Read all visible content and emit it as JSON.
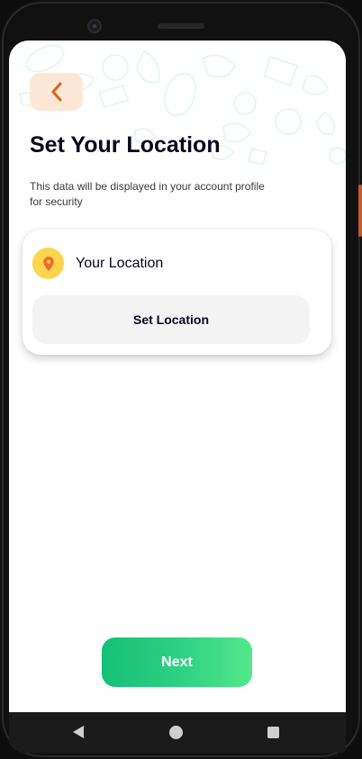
{
  "screen": {
    "title": "Set Your Location",
    "subtitle": "This data will be displayed in your account profile for security",
    "back_icon": "chevron-left-icon"
  },
  "location_card": {
    "icon": "map-pin-icon",
    "title": "Your Location",
    "button_label": "Set Location"
  },
  "footer": {
    "next_label": "Next"
  },
  "colors": {
    "accent_start": "#15BE77",
    "accent_end": "#53E88B",
    "back_button_bg": "#FDE7D6",
    "back_icon": "#DA6317",
    "pin_circle": "#FCD54D",
    "pin": "#F06A2A",
    "title_text": "#09051C",
    "set_location_bg": "#F4F4F4"
  },
  "system_nav": {
    "back_icon": "triangle-back-icon",
    "home_icon": "circle-home-icon",
    "recents_icon": "square-recents-icon"
  }
}
